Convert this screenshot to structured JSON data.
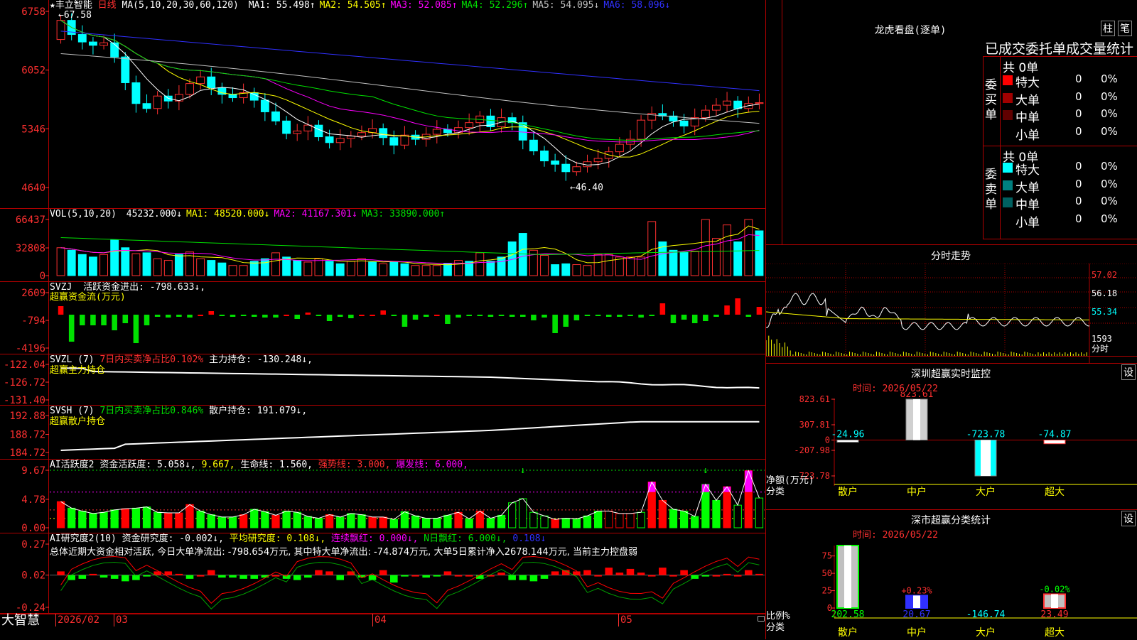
{
  "header": {
    "stock_name": "★丰立智能",
    "period": "日线",
    "ma_title": "MA(5,10,20,30,60,120)",
    "ma_items": [
      {
        "label": "MA1: 55.498↑",
        "color": "#ffffff"
      },
      {
        "label": "MA2: 54.505↑",
        "color": "#ffff00"
      },
      {
        "label": "MA3: 52.085↑",
        "color": "#ff00ff"
      },
      {
        "label": "MA4: 52.296↑",
        "color": "#00e000"
      },
      {
        "label": "MA5: 54.095↓",
        "color": "#c0c0c0"
      },
      {
        "label": "MA6: 58.096↓",
        "color": "#3030ff"
      }
    ],
    "high_mark": "67.58",
    "low_mark": "←46.40"
  },
  "price_axis": [
    "6758",
    "6052",
    "5346",
    "4640"
  ],
  "vol": {
    "title": "VOL(5,10,20)",
    "items": [
      {
        "label": "45232.000↓",
        "color": "#ffffff"
      },
      {
        "label": "MA1: 48520.000↓",
        "color": "#ffff00"
      },
      {
        "label": "MA2: 41167.301↓",
        "color": "#ff00ff"
      },
      {
        "label": "MA3: 33890.000↑",
        "color": "#00e000"
      }
    ],
    "axis": [
      "66437",
      "32808",
      "0"
    ]
  },
  "svzj": {
    "title": "SVZJ",
    "line1": "活跃资金进出: -798.633↓,",
    "line2": "超赢资金流(万元)",
    "axis": [
      "2609",
      "-794",
      "-4196"
    ]
  },
  "svzl": {
    "title": "SVZL (7)",
    "part1": "7日内买卖净占比0.102%",
    "part2": "主力持仓: -130.248↓,",
    "line2": "超赢主力持仓",
    "axis": [
      "-122.04",
      "-126.72",
      "-131.40"
    ]
  },
  "svsh": {
    "title": "SVSH (7)",
    "part1": "7日内买卖净占比0.846%",
    "part2": "散户持仓: 191.079↓,",
    "line2": "超赢散户持仓",
    "axis": [
      "192.88",
      "188.72",
      "184.72"
    ]
  },
  "ai1": {
    "title": "AI活跃度2",
    "part1": "资金活跃度: 5.058↓,",
    "part2": "9.667,",
    "part3": "生命线: 1.560,",
    "part4": "强势线: 3.000,",
    "part5": "爆发线: 6.000,",
    "axis": [
      "9.67",
      "4.78",
      "0.00"
    ]
  },
  "ai2": {
    "title": "AI研究度2(10)",
    "part1": "资金研究度: -0.002↓,",
    "part2": "平均研究度: 0.108↓,",
    "part3": "连续飘红: 0.000↓,",
    "part4": "N日飘红: 6.000↓,",
    "part5": "0.108↓",
    "summary": "总体近期大资金相对活跃, 今日大单净流出: -798.654万元, 其中特大单净流出: -74.874万元, 大单5日累计净入2678.144万元, 当前主力控盘弱",
    "axis": [
      "0.27",
      "0.02",
      "-0.24"
    ]
  },
  "bottom_bar": {
    "logo": "大智慧",
    "dates": [
      "2026/02",
      "03",
      "04",
      "05"
    ]
  },
  "longhu": {
    "title": "龙虎看盘(逐单)",
    "btn_column": "柱",
    "btn_stroke": "笔",
    "tabs_label": "已成交委托单成交量统计",
    "buy_side": "委买单",
    "sell_side": "委卖单",
    "buy_total": "共 0单",
    "sell_total": "共 0单",
    "buy_rows": [
      {
        "label": "特大",
        "value": "0",
        "pct": "0%",
        "color": "#ff0000"
      },
      {
        "label": "大单",
        "value": "0",
        "pct": "0%",
        "color": "#a00000"
      },
      {
        "label": "中单",
        "value": "0",
        "pct": "0%",
        "color": "#600000"
      },
      {
        "label": "小单",
        "value": "0",
        "pct": "0%",
        "color": "#000000"
      }
    ],
    "sell_rows": [
      {
        "label": "特大",
        "value": "0",
        "pct": "0%",
        "color": "#00ffff"
      },
      {
        "label": "大单",
        "value": "0",
        "pct": "0%",
        "color": "#008080"
      },
      {
        "label": "中单",
        "value": "0",
        "pct": "0%",
        "color": "#006060"
      },
      {
        "label": "小单",
        "value": "0",
        "pct": "0%",
        "color": "#000000"
      }
    ]
  },
  "fenshi": {
    "title": "分时走势",
    "axis": [
      "57.02",
      "56.18",
      "55.34"
    ],
    "vol_label": "1593",
    "vol_unit": "分时"
  },
  "monitor": {
    "title": "深圳超赢实时监控",
    "btn": "设",
    "time": "时间: 2026/05/22",
    "axis_label": "净额(万元)",
    "axis_label2": "分类",
    "axis": [
      "823.61",
      "307.81",
      "0",
      "-207.98",
      "-723.78"
    ]
  },
  "stats": {
    "title": "深市超赢分类统计",
    "btn": "设",
    "time": "时间: 2026/05/22",
    "axis_label": "比例%",
    "axis_label2": "分类",
    "axis": [
      "75",
      "50",
      "25",
      "0"
    ]
  },
  "monitor_chart": {
    "type": "bar",
    "categories": [
      "散户",
      "中户",
      "大户",
      "超大"
    ],
    "values": [
      -24.96,
      823.61,
      -723.78,
      -74.87
    ],
    "value_labels": [
      "-24.96",
      "823.61",
      "-723.78",
      "-74.87"
    ],
    "ylim": [
      -723.78,
      823.61
    ]
  },
  "stats_chart": {
    "type": "bar",
    "categories": [
      "散户",
      "中户",
      "大户",
      "超大"
    ],
    "values": [
      202.58,
      20.67,
      -146.74,
      23.49
    ],
    "value_labels": [
      "202.58",
      "20.67",
      "-146.74",
      "23.49"
    ],
    "pct_labels": [
      "",
      "+0.23%",
      "",
      "-0.02%"
    ],
    "ylim": [
      0,
      75
    ]
  },
  "chart_data": {
    "type": "candlestick",
    "price_axis_ticks": [
      67.58,
      60.52,
      53.46,
      46.4
    ],
    "candles_close": [
      66.5,
      64.8,
      63.9,
      63.5,
      63.8,
      62.1,
      59.0,
      56.5,
      55.9,
      57.4,
      56.8,
      57.6,
      58.9,
      59.7,
      58.4,
      57.6,
      57.2,
      57.8,
      56.9,
      55.5,
      54.4,
      52.9,
      53.2,
      53.9,
      52.5,
      51.8,
      52.3,
      52.6,
      53.0,
      53.5,
      52.4,
      51.5,
      52.7,
      52.2,
      52.8,
      53.4,
      53.0,
      53.6,
      54.2,
      55.0,
      53.7,
      54.8,
      54.2,
      52.1,
      50.8,
      49.6,
      49.2,
      48.3,
      48.9,
      49.5,
      49.9,
      50.7,
      51.6,
      52.2,
      54.5,
      55.3,
      55.0,
      54.4,
      53.8,
      54.8,
      55.7,
      56.3,
      56.8,
      55.9,
      56.5,
      56.6
    ],
    "volume_ma_note": "VOL MA(5,10,20)"
  }
}
